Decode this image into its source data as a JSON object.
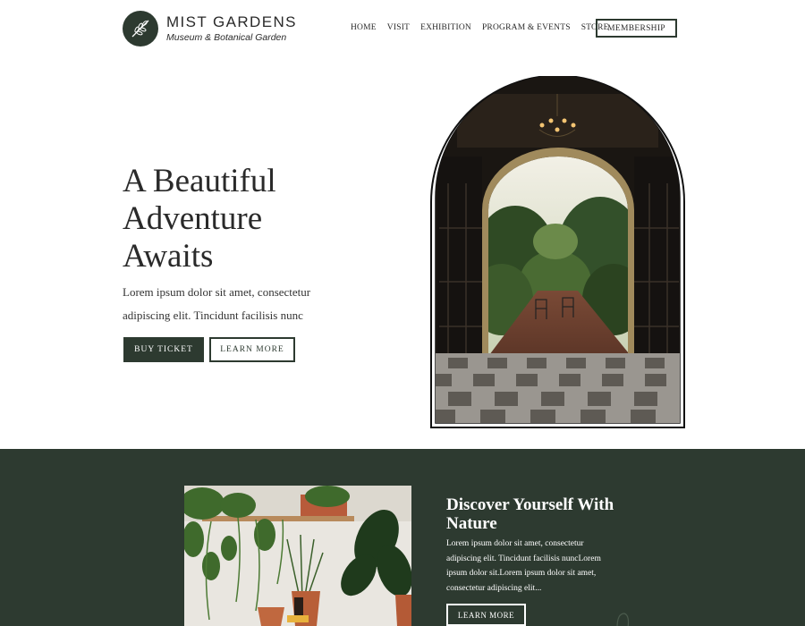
{
  "header": {
    "logo": {
      "name": "MIST GARDENS",
      "subtitle": "Museum & Botanical Garden",
      "icon": "leaf-sprig-icon"
    },
    "nav": [
      {
        "label": "HOME"
      },
      {
        "label": "VISIT"
      },
      {
        "label": "EXHIBITION"
      },
      {
        "label": "PROGRAM & EVENTS"
      },
      {
        "label": "STORE"
      }
    ],
    "membership_label": "MEMBERSHIP"
  },
  "hero": {
    "title_lines": [
      "A Beautiful",
      "Adventure",
      "Awaits"
    ],
    "text_lines": [
      "Lorem ipsum dolor sit amet, consectetur",
      "adipiscing elit. Tincidunt facilisis nunc"
    ],
    "buy_label": "BUY TICKET",
    "learn_label": "LEARN MORE",
    "image": "arched-doorway-garden-photo"
  },
  "discover": {
    "title_lines": [
      "Discover Yourself With",
      "Nature"
    ],
    "text_lines": [
      "Lorem ipsum dolor sit amet, consectetur",
      "adipiscing elit. Tincidunt facilisis nuncLorem",
      "ipsum dolor sit.Lorem ipsum dolor sit amet,",
      "consectetur adipiscing elit..."
    ],
    "learn_label": "LEARN MORE",
    "image": "potted-plants-shelf-photo"
  },
  "colors": {
    "primary": "#2d3a30",
    "white": "#ffffff",
    "text": "#2a2a2a"
  }
}
